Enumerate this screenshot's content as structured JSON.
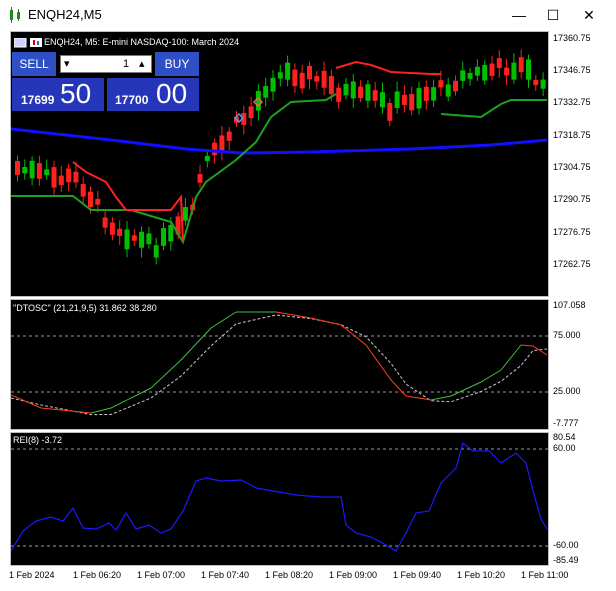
{
  "window": {
    "title": "ENQH24,M5",
    "minimize": "—",
    "maximize": "☐",
    "close": "✕"
  },
  "chart": {
    "description": "ENQH24, M5:  E-mini NASDAQ-100: March 2024",
    "y_labels": [
      "17360.75",
      "17346.75",
      "17332.75",
      "17318.75",
      "17304.75",
      "17290.75",
      "17276.75",
      "17262.75"
    ],
    "x_labels": [
      "1 Feb 2024",
      "1 Feb 06:20",
      "1 Feb 07:00",
      "1 Feb 07:40",
      "1 Feb 08:20",
      "1 Feb 09:00",
      "1 Feb 09:40",
      "1 Feb 10:20",
      "1 Feb 11:00"
    ],
    "colors": {
      "bull": "#00c000",
      "bear": "#ff2020",
      "ma": "#1010ff",
      "stop_up": "#20a020",
      "stop_down": "#ff2020"
    }
  },
  "trade_panel": {
    "sell_label": "SELL",
    "buy_label": "BUY",
    "volume": "1",
    "bid_small": "17699",
    "bid_big": "50",
    "ask_small": "17700",
    "ask_big": "00",
    "minus": "▾",
    "plus": "▴"
  },
  "dtosc": {
    "title": "\"DTOSC\" (21,21,9,5) 31.862 38.280",
    "y_labels": [
      "107.058",
      "75.000",
      "25.000",
      "-7.777"
    ]
  },
  "rei": {
    "title": "REI(8) -3.72",
    "y_labels": [
      "80.54",
      "60.00",
      "-60.00",
      "-85.49"
    ]
  }
}
